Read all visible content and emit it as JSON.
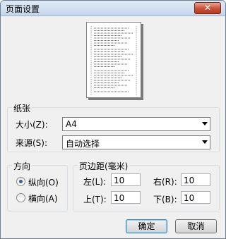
{
  "window": {
    "title": "页面设置",
    "close": "✕"
  },
  "paper": {
    "group_title": "纸张",
    "size_label": "大小(Z):",
    "size_value": "A4",
    "source_label": "来源(S):",
    "source_value": "自动选择"
  },
  "orientation": {
    "group_title": "方向",
    "portrait": "纵向(O)",
    "landscape": "横向(A)",
    "selected": "portrait"
  },
  "margins": {
    "group_title": "页边距(毫米)",
    "left_label": "左(L):",
    "left_value": "10",
    "right_label": "右(R):",
    "right_value": "10",
    "top_label": "上(T):",
    "top_value": "10",
    "bottom_label": "下(B):",
    "bottom_value": "10"
  },
  "buttons": {
    "ok": "确定",
    "cancel": "取消"
  }
}
